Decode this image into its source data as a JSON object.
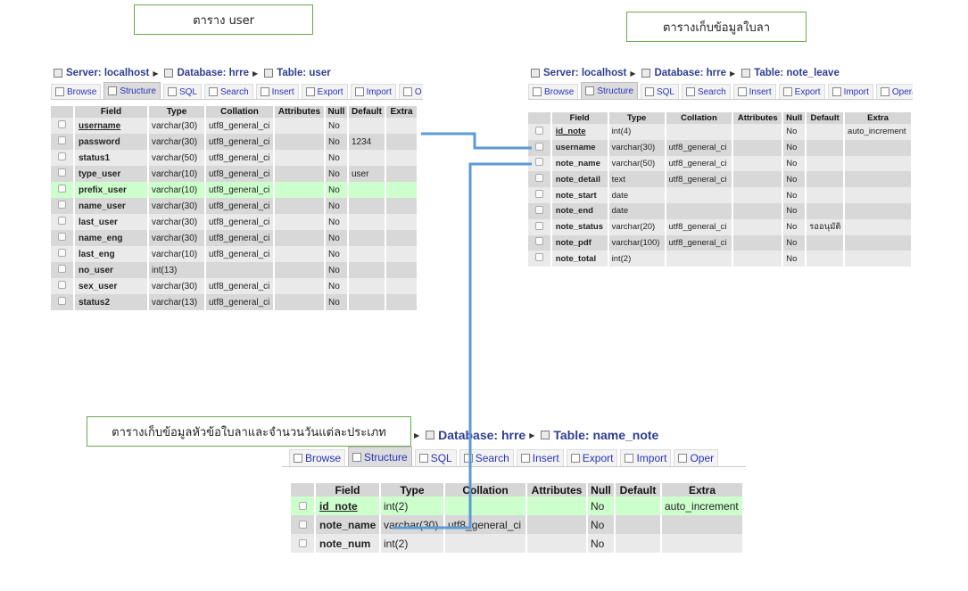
{
  "captions": {
    "user": "ตาราง user",
    "leave": "ตารางเก็บข้อมูลใบลา",
    "name_note": "ตารางเก็บข้อมูลหัวข้อใบลาและจำนวนวันแต่ละประเภท"
  },
  "common": {
    "server_label": "Server: localhost",
    "database_label": "Database: hrre",
    "database_label_partial": "Database: hrre",
    "tabs": {
      "browse": "Browse",
      "structure": "Structure",
      "sql": "SQL",
      "search": "Search",
      "insert": "Insert",
      "export": "Export",
      "import": "Import",
      "operations_user": "O",
      "operations_leave": "Operat",
      "operations_note": "Oper"
    },
    "headers": {
      "field": "Field",
      "type": "Type",
      "collation": "Collation",
      "attributes": "Attributes",
      "null": "Null",
      "default": "Default",
      "extra": "Extra"
    }
  },
  "user_table": {
    "table_label": "Table: user",
    "rows": [
      {
        "field": "username",
        "type": "varchar(30)",
        "collation": "utf8_general_ci",
        "null": "No",
        "default": "",
        "extra": ""
      },
      {
        "field": "password",
        "type": "varchar(30)",
        "collation": "utf8_general_ci",
        "null": "No",
        "default": "1234",
        "extra": ""
      },
      {
        "field": "status1",
        "type": "varchar(50)",
        "collation": "utf8_general_ci",
        "null": "No",
        "default": "",
        "extra": ""
      },
      {
        "field": "type_user",
        "type": "varchar(10)",
        "collation": "utf8_general_ci",
        "null": "No",
        "default": "user",
        "extra": ""
      },
      {
        "field": "prefix_user",
        "type": "varchar(10)",
        "collation": "utf8_general_ci",
        "null": "No",
        "default": "",
        "extra": ""
      },
      {
        "field": "name_user",
        "type": "varchar(30)",
        "collation": "utf8_general_ci",
        "null": "No",
        "default": "",
        "extra": ""
      },
      {
        "field": "last_user",
        "type": "varchar(30)",
        "collation": "utf8_general_ci",
        "null": "No",
        "default": "",
        "extra": ""
      },
      {
        "field": "name_eng",
        "type": "varchar(30)",
        "collation": "utf8_general_ci",
        "null": "No",
        "default": "",
        "extra": ""
      },
      {
        "field": "last_eng",
        "type": "varchar(10)",
        "collation": "utf8_general_ci",
        "null": "No",
        "default": "",
        "extra": ""
      },
      {
        "field": "no_user",
        "type": "int(13)",
        "collation": "",
        "null": "No",
        "default": "",
        "extra": ""
      },
      {
        "field": "sex_user",
        "type": "varchar(30)",
        "collation": "utf8_general_ci",
        "null": "No",
        "default": "",
        "extra": ""
      },
      {
        "field": "status2",
        "type": "varchar(13)",
        "collation": "utf8_general_ci",
        "null": "No",
        "default": "",
        "extra": ""
      }
    ]
  },
  "leave_table": {
    "table_label": "Table: note_leave",
    "rows": [
      {
        "field": "id_note",
        "type": "int(4)",
        "collation": "",
        "null": "No",
        "default": "",
        "extra": "auto_increment"
      },
      {
        "field": "username",
        "type": "varchar(30)",
        "collation": "utf8_general_ci",
        "null": "No",
        "default": "",
        "extra": ""
      },
      {
        "field": "note_name",
        "type": "varchar(50)",
        "collation": "utf8_general_ci",
        "null": "No",
        "default": "",
        "extra": ""
      },
      {
        "field": "note_detail",
        "type": "text",
        "collation": "utf8_general_ci",
        "null": "No",
        "default": "",
        "extra": ""
      },
      {
        "field": "note_start",
        "type": "date",
        "collation": "",
        "null": "No",
        "default": "",
        "extra": ""
      },
      {
        "field": "note_end",
        "type": "date",
        "collation": "",
        "null": "No",
        "default": "",
        "extra": ""
      },
      {
        "field": "note_status",
        "type": "varchar(20)",
        "collation": "utf8_general_ci",
        "null": "No",
        "default": "รออนุมัติ",
        "extra": ""
      },
      {
        "field": "note_pdf",
        "type": "varchar(100)",
        "collation": "utf8_general_ci",
        "null": "No",
        "default": "",
        "extra": ""
      },
      {
        "field": "note_total",
        "type": "int(2)",
        "collation": "",
        "null": "No",
        "default": "",
        "extra": ""
      }
    ]
  },
  "note_table": {
    "table_label": "Table: name_note",
    "rows": [
      {
        "field": "id_note",
        "type": "int(2)",
        "collation": "",
        "null": "No",
        "default": "",
        "extra": "auto_increment"
      },
      {
        "field": "note_name",
        "type": "varchar(30)",
        "collation": "utf8_general_ci",
        "null": "No",
        "default": "",
        "extra": ""
      },
      {
        "field": "note_num",
        "type": "int(2)",
        "collation": "",
        "null": "No",
        "default": "",
        "extra": ""
      }
    ]
  },
  "colors": {
    "connector": "#5b9bd5",
    "caption_border": "#6aa84f",
    "breadcrumb": "#2d3e91",
    "highlight_row": "#ccffcc"
  }
}
